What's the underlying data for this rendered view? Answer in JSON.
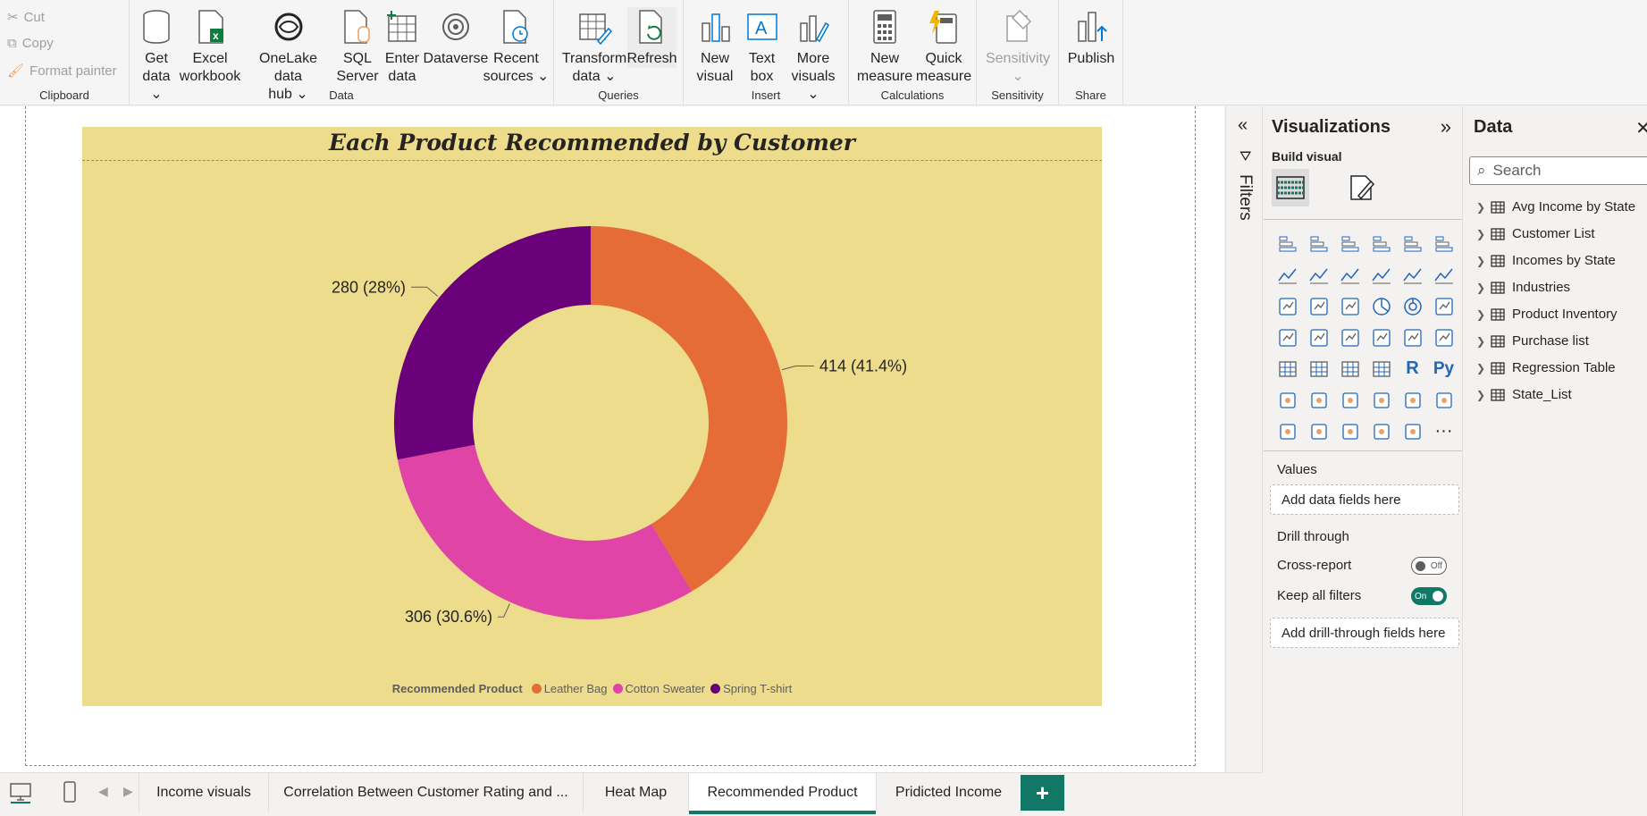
{
  "ribbon": {
    "clipboard": {
      "cut": "Cut",
      "copy": "Copy",
      "format_painter": "Format painter",
      "label": "Clipboard"
    },
    "data_group": {
      "label": "Data",
      "get_data": "Get\ndata ⌄",
      "excel": "Excel\nworkbook",
      "onelake": "OneLake data\nhub ⌄",
      "sql": "SQL\nServer",
      "enter_data": "Enter\ndata",
      "dataverse": "Dataverse",
      "recent": "Recent\nsources ⌄"
    },
    "queries": {
      "label": "Queries",
      "transform": "Transform\ndata ⌄",
      "refresh": "Refresh"
    },
    "insert": {
      "label": "Insert",
      "new_visual": "New\nvisual",
      "text_box": "Text\nbox",
      "more_visuals": "More\nvisuals ⌄"
    },
    "calculations": {
      "label": "Calculations",
      "new_measure": "New\nmeasure",
      "quick_measure": "Quick\nmeasure"
    },
    "sensitivity": {
      "label": "Sensitivity",
      "button": "Sensitivity\n⌄"
    },
    "share": {
      "label": "Share",
      "publish": "Publish"
    }
  },
  "chart_data": {
    "type": "pie",
    "title": "Each Product Recommended by Customer",
    "legend_title": "Recommended Product",
    "legend_position": "bottom-center",
    "categories": [
      "Leather Bag",
      "Cotton Sweater",
      "Spring T-shirt"
    ],
    "values": [
      414,
      306,
      280
    ],
    "labels": [
      "414 (41.4%)",
      "306 (30.6%)",
      "280 (28%)"
    ],
    "colors": [
      "#e66c37",
      "#e044a7",
      "#6b007b"
    ],
    "background": "#ecdc8c"
  },
  "filters_strip": {
    "label": "Filters"
  },
  "visualizations": {
    "title": "Visualizations",
    "build_visual": "Build visual",
    "values_label": "Values",
    "values_placeholder": "Add data fields here",
    "drill_through": "Drill through",
    "cross_report": "Cross-report",
    "cross_report_state": "Off",
    "keep_filters": "Keep all filters",
    "keep_filters_state": "On",
    "drill_placeholder": "Add drill-through fields here"
  },
  "data_pane": {
    "title": "Data",
    "search_placeholder": "Search",
    "tables": [
      "Avg Income by State",
      "Customer List",
      "Incomes by State",
      "Industries",
      "Product Inventory",
      "Purchase list",
      "Regression Table",
      "State_List"
    ]
  },
  "page_tabs": [
    "Income visuals",
    "Correlation Between Customer Rating and ...",
    "Heat Map",
    "Recommended Product",
    "Pridicted Income"
  ],
  "active_tab_index": 3,
  "accent_color": "#117865"
}
